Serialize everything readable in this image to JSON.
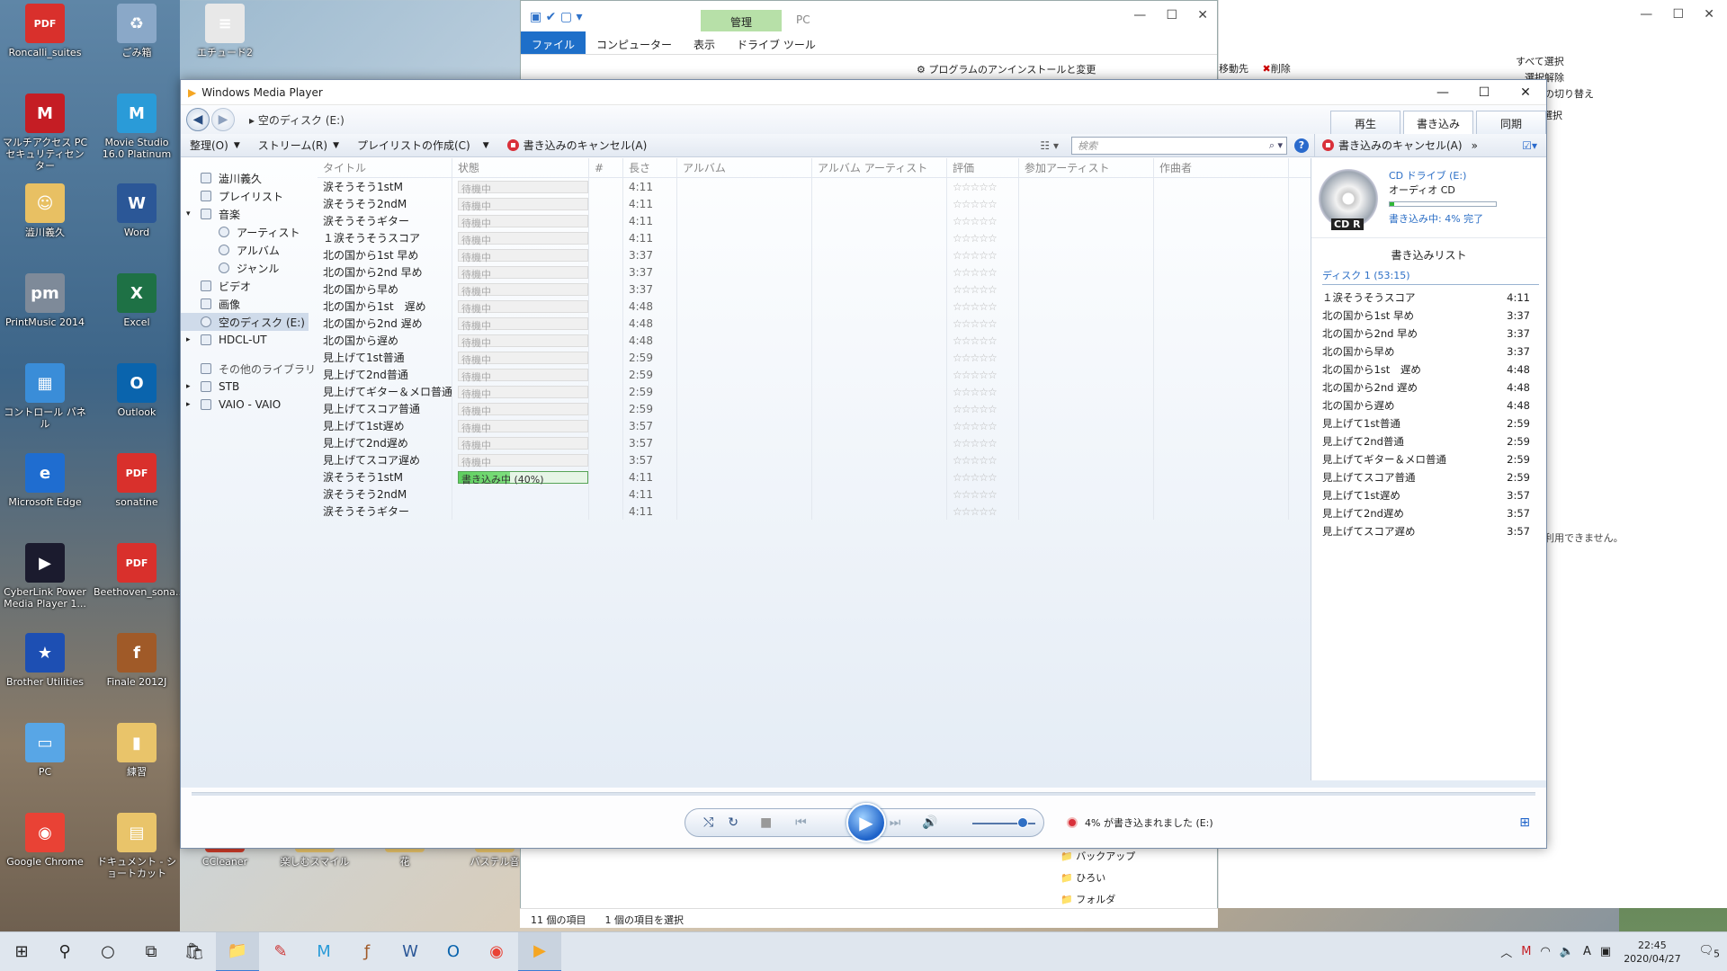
{
  "desktop_icons": [
    {
      "label": "Roncalli_suites",
      "glyph": "PDF",
      "color": "#d9302c"
    },
    {
      "label": "ごみ箱",
      "glyph": "♻",
      "color": "#8aa8c8"
    },
    {
      "label": "エチュード2",
      "glyph": "≡",
      "color": "#e8e8e8"
    },
    {
      "label": "マルチアクセス PC セキュリティセンター",
      "glyph": "M",
      "color": "#c51d24"
    },
    {
      "label": "Movie Studio 16.0 Platinum",
      "glyph": "M",
      "color": "#2a9bd8"
    },
    {
      "label": "澁川義久",
      "glyph": "☺",
      "color": "#e8c063"
    },
    {
      "label": "Word",
      "glyph": "W",
      "color": "#2b5797"
    },
    {
      "label": "PrintMusic 2014",
      "glyph": "pm",
      "color": "#7e8a99"
    },
    {
      "label": "Excel",
      "glyph": "X",
      "color": "#1e7145"
    },
    {
      "label": "コントロール パネル",
      "glyph": "▦",
      "color": "#3a8dd8"
    },
    {
      "label": "Outlook",
      "glyph": "O",
      "color": "#0a64ad"
    },
    {
      "label": "Microsoft Edge",
      "glyph": "e",
      "color": "#1f6dd0"
    },
    {
      "label": "sonatine",
      "glyph": "PDF",
      "color": "#d9302c"
    },
    {
      "label": "CyberLink Power Media Player 1...",
      "glyph": "▶",
      "color": "#1b1b2e"
    },
    {
      "label": "Beethoven_sona...",
      "glyph": "PDF",
      "color": "#d9302c"
    },
    {
      "label": "Brother Utilities",
      "glyph": "★",
      "color": "#1d4fb3"
    },
    {
      "label": "Finale 2012J",
      "glyph": "f",
      "color": "#a05a28"
    },
    {
      "label": "PC",
      "glyph": "▭",
      "color": "#58a6e6"
    },
    {
      "label": "練習",
      "glyph": "▮",
      "color": "#e9c46a"
    },
    {
      "label": "Google Chrome",
      "glyph": "◉",
      "color": "#e94235"
    },
    {
      "label": "ドキュメント - ショートカット",
      "glyph": "▤",
      "color": "#e9c46a"
    },
    {
      "label": "CCleaner",
      "glyph": "C",
      "color": "#d03c2a"
    },
    {
      "label": "楽しむスマイル",
      "glyph": "▮",
      "color": "#e9c46a"
    },
    {
      "label": "花",
      "glyph": "▮",
      "color": "#e9c46a"
    },
    {
      "label": "パステル音",
      "glyph": "▮",
      "color": "#e9c46a"
    }
  ],
  "explorer": {
    "manage_tab": "管理",
    "title": "PC",
    "tabs": [
      "ファイル",
      "コンピューター",
      "表示",
      "ドライブ ツール"
    ],
    "uninstall": "プログラムのアンインストールと変更",
    "ribbon_right": [
      "移動先",
      "削除",
      "すべて選択",
      "選択解除",
      "選択の切り替え",
      "選択"
    ],
    "unavailable": "ーを利用できません。",
    "folders": [
      "バックアップ",
      "ひろい",
      "フォルダ"
    ],
    "footer_items": "11 個の項目",
    "footer_selected": "1 個の項目を選択"
  },
  "wmp": {
    "title": "Windows Media Player",
    "breadcrumb": "空のディスク (E:)",
    "mode_tabs": [
      "再生",
      "書き込み",
      "同期"
    ],
    "toolbar": {
      "organize": "整理(O)",
      "stream": "ストリーム(R)",
      "create_playlist": "プレイリストの作成(C)",
      "cancel_burn": "書き込みのキャンセル(A)",
      "search_placeholder": "検索"
    },
    "nav": {
      "user": "澁川義久",
      "playlists": "プレイリスト",
      "music": "音楽",
      "artist": "アーティスト",
      "album": "アルバム",
      "genre": "ジャンル",
      "video": "ビデオ",
      "pictures": "画像",
      "blank_disc": "空のディスク (E:)",
      "hdcl": "HDCL-UT",
      "other_libraries": "その他のライブラリ",
      "stb": "STB",
      "vaio": "VAIO - VAIO"
    },
    "columns": [
      "タイトル",
      "状態",
      "#",
      "長さ",
      "アルバム",
      "アルバム アーティスト",
      "評価",
      "参加アーティスト",
      "作曲者"
    ],
    "tracks": [
      {
        "title": "涙そうそう1stM",
        "status": "待機中",
        "length": "4:11"
      },
      {
        "title": "涙そうそう2ndM",
        "status": "待機中",
        "length": "4:11"
      },
      {
        "title": "涙そうそうギター",
        "status": "待機中",
        "length": "4:11"
      },
      {
        "title": "１涙そうそうスコア",
        "status": "待機中",
        "length": "4:11"
      },
      {
        "title": "北の国から1st 早め",
        "status": "待機中",
        "length": "3:37"
      },
      {
        "title": "北の国から2nd 早め",
        "status": "待機中",
        "length": "3:37"
      },
      {
        "title": "北の国から早め",
        "status": "待機中",
        "length": "3:37"
      },
      {
        "title": "北の国から1st　遅め",
        "status": "待機中",
        "length": "4:48"
      },
      {
        "title": "北の国から2nd 遅め",
        "status": "待機中",
        "length": "4:48"
      },
      {
        "title": "北の国から遅め",
        "status": "待機中",
        "length": "4:48"
      },
      {
        "title": "見上げて1st普通",
        "status": "待機中",
        "length": "2:59"
      },
      {
        "title": "見上げて2nd普通",
        "status": "待機中",
        "length": "2:59"
      },
      {
        "title": "見上げてギター＆メロ普通",
        "status": "待機中",
        "length": "2:59"
      },
      {
        "title": "見上げてスコア普通",
        "status": "待機中",
        "length": "2:59"
      },
      {
        "title": "見上げて1st遅め",
        "status": "待機中",
        "length": "3:57"
      },
      {
        "title": "見上げて2nd遅め",
        "status": "待機中",
        "length": "3:57"
      },
      {
        "title": "見上げてスコア遅め",
        "status": "待機中",
        "length": "3:57"
      },
      {
        "title": "涙そうそう1stM",
        "status": "書き込み中 (40%)",
        "length": "4:11",
        "active": true
      },
      {
        "title": "涙そうそう2ndM",
        "status": "",
        "length": "4:11"
      },
      {
        "title": "涙そうそうギター",
        "status": "",
        "length": "4:11"
      }
    ],
    "burn_panel": {
      "cancel": "書き込みのキャンセル(A)",
      "drive": "CD ドライブ (E:)",
      "type": "オーディオ CD",
      "disc_label": "CD R",
      "progress_text": "書き込み中: 4% 完了",
      "progress": 0.04,
      "list_title": "書き込みリスト",
      "disc_header": "ディスク 1 (53:15)",
      "items": [
        {
          "title": "１涙そうそうスコア",
          "length": "4:11"
        },
        {
          "title": "北の国から1st 早め",
          "length": "3:37"
        },
        {
          "title": "北の国から2nd 早め",
          "length": "3:37"
        },
        {
          "title": "北の国から早め",
          "length": "3:37"
        },
        {
          "title": "北の国から1st　遅め",
          "length": "4:48"
        },
        {
          "title": "北の国から2nd 遅め",
          "length": "4:48"
        },
        {
          "title": "北の国から遅め",
          "length": "4:48"
        },
        {
          "title": "見上げて1st普通",
          "length": "2:59"
        },
        {
          "title": "見上げて2nd普通",
          "length": "2:59"
        },
        {
          "title": "見上げてギター＆メロ普通",
          "length": "2:59"
        },
        {
          "title": "見上げてスコア普通",
          "length": "2:59"
        },
        {
          "title": "見上げて1st遅め",
          "length": "3:57"
        },
        {
          "title": "見上げて2nd遅め",
          "length": "3:57"
        },
        {
          "title": "見上げてスコア遅め",
          "length": "3:57"
        }
      ]
    },
    "status_bar": "4% が書き込まれました (E:)",
    "volume": 0.8
  },
  "taskbar": {
    "time": "22:45",
    "date": "2020/04/27",
    "notifications": "5",
    "ime": "A"
  }
}
